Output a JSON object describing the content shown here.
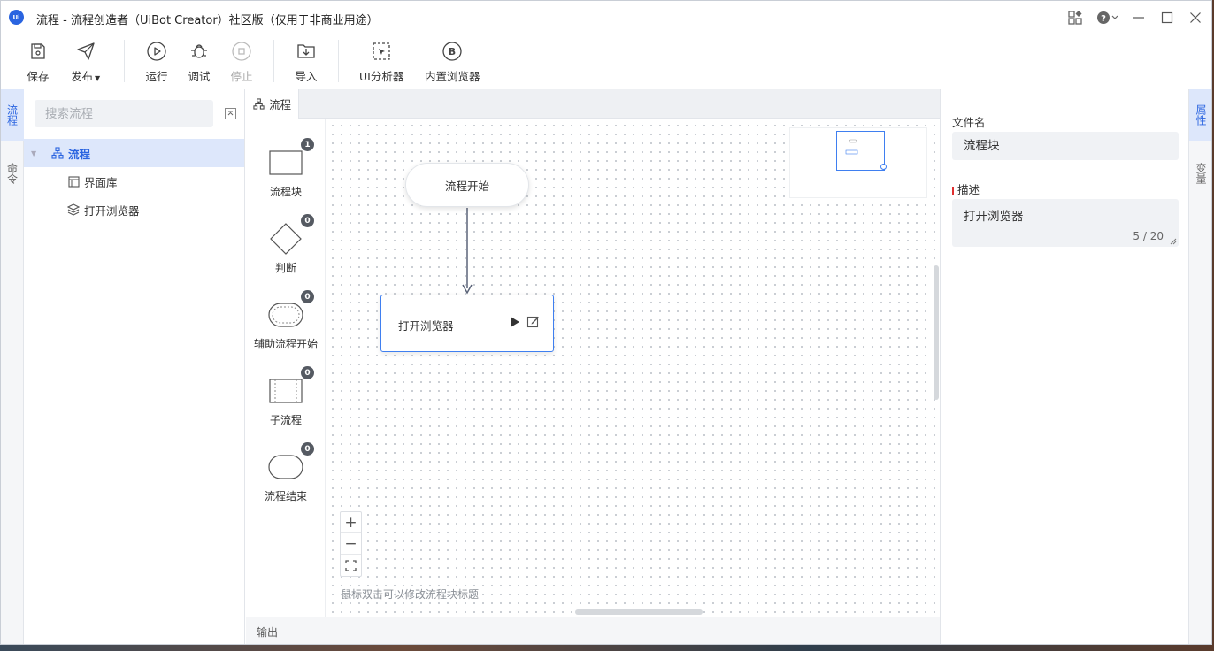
{
  "titlebar": {
    "logo": "Ui",
    "title": "流程 - 流程创造者（UiBot Creator）社区版（仅用于非商业用途）",
    "icons": [
      "apps-icon",
      "help-icon",
      "minimize-icon",
      "maximize-icon",
      "close-icon"
    ]
  },
  "toolbar": {
    "save": "保存",
    "publish": "发布",
    "run": "运行",
    "debug": "调试",
    "stop": "停止",
    "import": "导入",
    "ui_analyzer": "UI分析器",
    "builtin_browser": "内置浏览器"
  },
  "left_strip": {
    "tabs": [
      "流程",
      "命令"
    ]
  },
  "tree": {
    "search_placeholder": "搜索流程",
    "root": "流程",
    "children": [
      "界面库",
      "打开浏览器"
    ]
  },
  "editor": {
    "tab": "流程",
    "palette": [
      {
        "label": "流程块",
        "count": "1"
      },
      {
        "label": "判断",
        "count": "0"
      },
      {
        "label": "辅助流程开始",
        "count": "0"
      },
      {
        "label": "子流程",
        "count": "0"
      },
      {
        "label": "流程结束",
        "count": "0"
      }
    ],
    "start_node": "流程开始",
    "block_node": "打开浏览器",
    "zoom": [
      "+",
      "−",
      "⛶"
    ],
    "hint": "鼠标双击可以修改流程块标题"
  },
  "output": {
    "label": "输出"
  },
  "properties": {
    "filename_label": "文件名",
    "filename_value": "流程块",
    "desc_label": "描述",
    "desc_value": "打开浏览器",
    "desc_counter": "5 / 20"
  },
  "right_strip": {
    "tabs": [
      "属性",
      "变量"
    ]
  },
  "colors": {
    "accent": "#3f7ff0",
    "selected_bg": "#dde7fb",
    "badge": "#555a62"
  }
}
